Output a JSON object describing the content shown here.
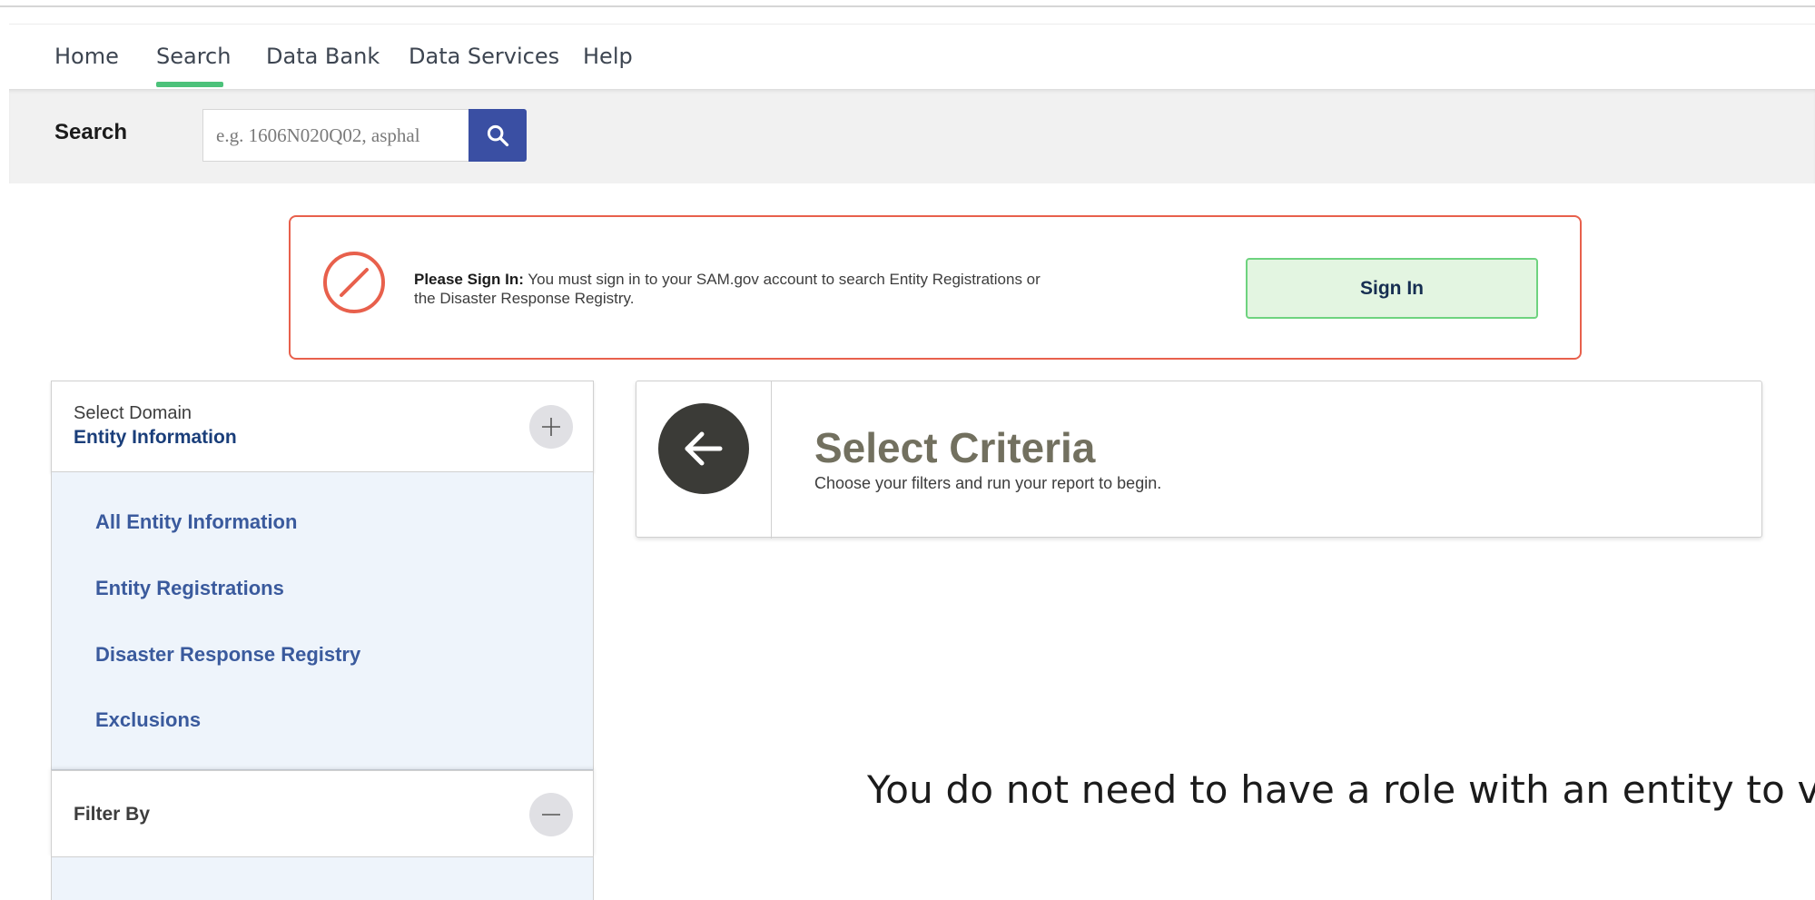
{
  "nav": {
    "items": [
      {
        "label": "Home"
      },
      {
        "label": "Search",
        "active": true
      },
      {
        "label": "Data Bank"
      },
      {
        "label": "Data Services"
      },
      {
        "label": "Help"
      }
    ],
    "active_color": "#4cc27a"
  },
  "search": {
    "label": "Search",
    "placeholder": "e.g. 1606N020Q02, asphal",
    "button_icon": "search-icon"
  },
  "alert": {
    "icon": "prohibited-icon",
    "title": "Please Sign In:",
    "message_line1": "You must sign in to your SAM.gov account to search Entity Registrations or",
    "message_line2": "the Disaster Response Registry.",
    "button_label": "Sign In",
    "border_color": "#e8604c"
  },
  "domain": {
    "heading": "Select Domain",
    "selected": "Entity Information",
    "toggle_icon": "plus-icon",
    "items": [
      {
        "label": "All Entity Information"
      },
      {
        "label": "Entity Registrations"
      },
      {
        "label": "Disaster Response Registry"
      },
      {
        "label": "Exclusions"
      }
    ]
  },
  "filter": {
    "label": "Filter By",
    "toggle_icon": "minus-icon"
  },
  "criteria": {
    "icon": "arrow-left-icon",
    "title": "Select Criteria",
    "subtitle": "Choose your filters and run your report to begin."
  },
  "caption": "You do not need to have a role with an entity to view"
}
